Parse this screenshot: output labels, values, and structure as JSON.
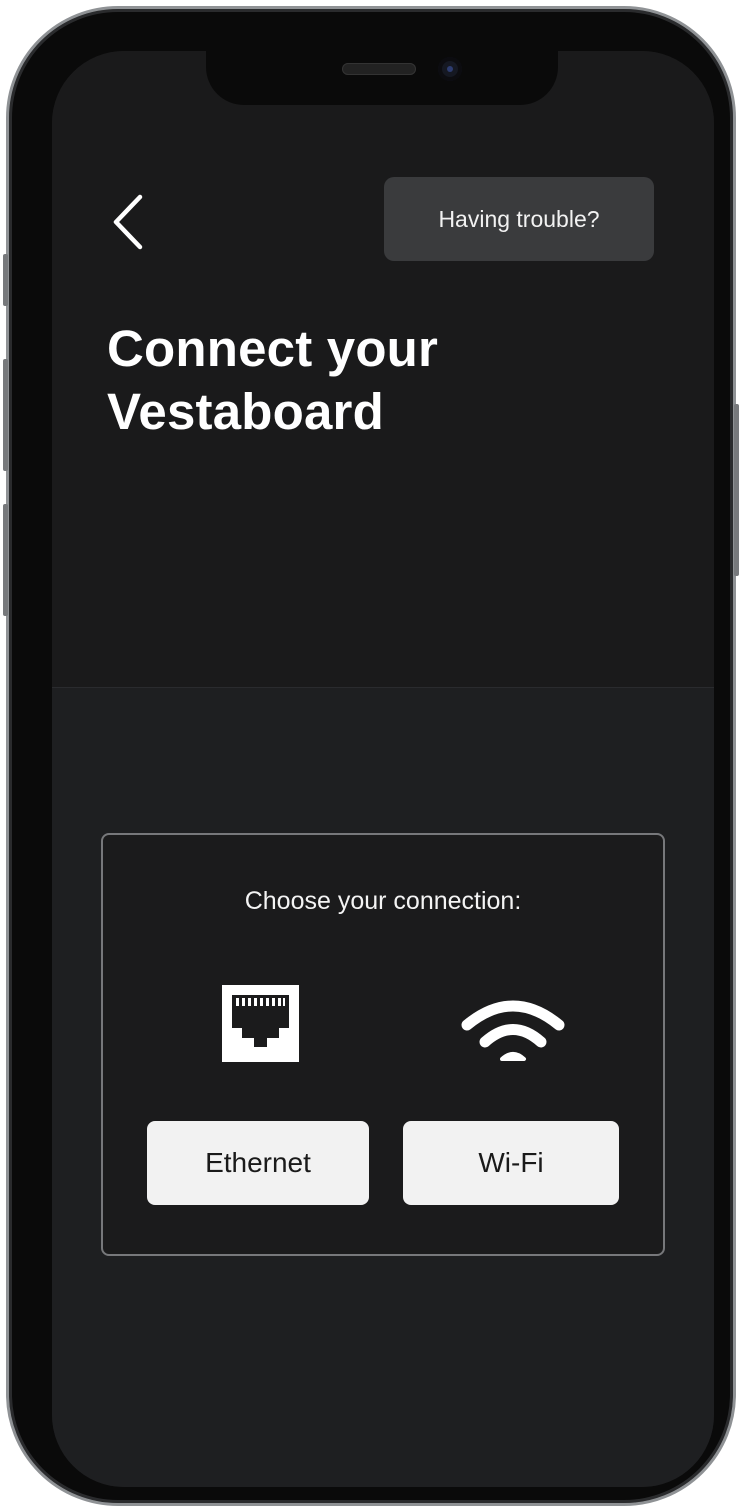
{
  "header": {
    "back_icon": "chevron-left-icon",
    "trouble_label": "Having trouble?"
  },
  "title": {
    "line1": "Connect your",
    "line2": "Vestaboard"
  },
  "connection": {
    "heading": "Choose your connection:",
    "options": [
      {
        "icon": "ethernet-port-icon",
        "label": "Ethernet"
      },
      {
        "icon": "wifi-icon",
        "label": "Wi-Fi"
      }
    ]
  },
  "colors": {
    "screen_background": "#1a1a1b",
    "lower_background": "#1e1f21",
    "button_background": "#f2f2f2",
    "trouble_button_background": "#3a3b3d",
    "text_primary": "#ffffff"
  }
}
